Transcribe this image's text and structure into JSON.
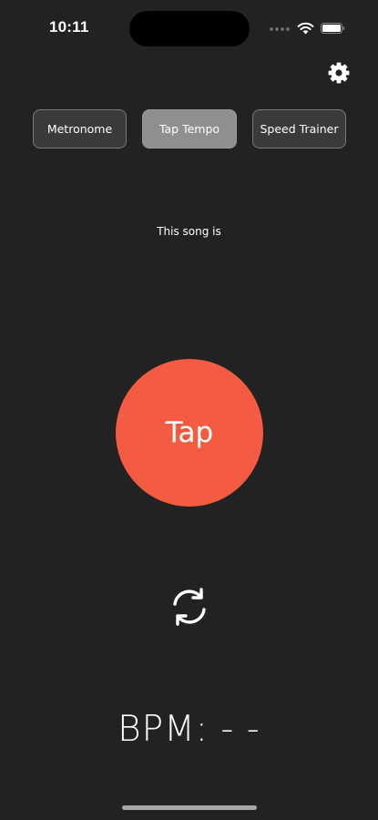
{
  "status_bar": {
    "time": "10:11",
    "icons": [
      "cellular-signal-icon",
      "wifi-icon",
      "battery-icon"
    ]
  },
  "header": {
    "settings_icon": "gear-icon"
  },
  "mode_tabs": [
    {
      "label": "Metronome",
      "selected": false
    },
    {
      "label": "Tap Tempo",
      "selected": true
    },
    {
      "label": "Speed Trainer",
      "selected": false
    }
  ],
  "main": {
    "prompt": "This song is",
    "tap_label": "Tap",
    "reset_icon": "refresh-icon",
    "bpm_text": "BPM: - -"
  },
  "colors": {
    "background": "#222222",
    "accent": "#f35c42",
    "tab_selected": "#8f8f8f",
    "tab_default": "#3a3a3a"
  }
}
